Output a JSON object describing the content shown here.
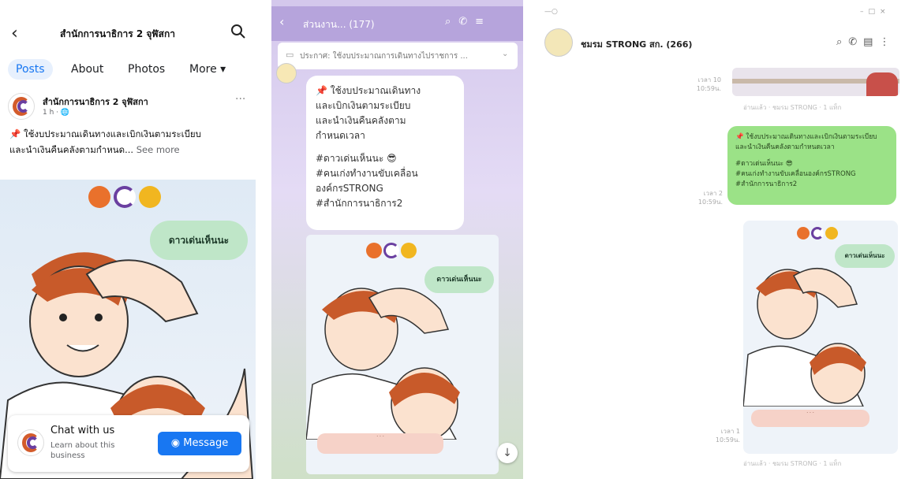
{
  "facebook": {
    "header_title": "สำนักการนาธิการ 2 จุฬัสกา",
    "tabs": [
      {
        "label": "Posts",
        "active": true
      },
      {
        "label": "About",
        "active": false
      },
      {
        "label": "Photos",
        "active": false
      },
      {
        "label": "More ▾",
        "active": false
      }
    ],
    "post": {
      "author": "สำนักการนาธิการ 2 จุฬัสกา",
      "meta": "1 h · 🌐",
      "text_line1": "📌 ใช้งบประมาณเดินทางและเบิกเงินตามระเบียบ",
      "text_line2": "และนำเงินคืนคลังตามกำหนด...",
      "see_more": "See more",
      "image_caption": "ดาวเด่นเห็นนะ"
    },
    "chat_card": {
      "title": "Chat with us",
      "subtitle": "Learn about this business",
      "button": "Message"
    },
    "colors": {
      "accent": "#1877f2"
    }
  },
  "line_mobile": {
    "header_title": "ส่วนงาน... (177)",
    "announcement": "ประกาศ: ใช้งบประมาณการเดินทางไปราชการ ...",
    "message_lines": [
      "📌 ใช้งบประมาณเดินทาง",
      "และเบิกเงินตามระเบียบ",
      "และนำเงินคืนคลังตาม",
      "กำหนดเวลา",
      "",
      "#ดาวเด่นเห็นนะ 😎",
      "#คนเก่งทำงานขับเคลื่อน",
      "องค์กรSTRONG",
      "#สำนักการนาธิการ2"
    ],
    "image_caption": "ดาวเด่นเห็นนะ",
    "scroll_down": "↓"
  },
  "line_desktop": {
    "chat_name": "ชมรม STRONG สก. (266)",
    "time_1": "เวลา 10 10:59น.",
    "read_1": "อ่านแล้ว · ชมรม STRONG · 1 แท็ก",
    "time_2": "เวลา 2 10:59น.",
    "green_lines": [
      "📌 ใช้งบประมาณเดินทางและเบิกเงินตามระเบียบ",
      "และนำเงินคืนคลังตามกำหนดเวลา",
      "",
      "#ดาวเด่นเห็นนะ 😎",
      "#คนเก่งทำงานขับเคลื่อนองค์กรSTRONG",
      "#สำนักการนาธิการ2"
    ],
    "time_3": "เวลา 1 10:59น.",
    "read_2": "อ่านแล้ว · ชมรม STRONG · 1 แท็ก",
    "image_caption": "ดาวเด่นเห็นนะ"
  }
}
